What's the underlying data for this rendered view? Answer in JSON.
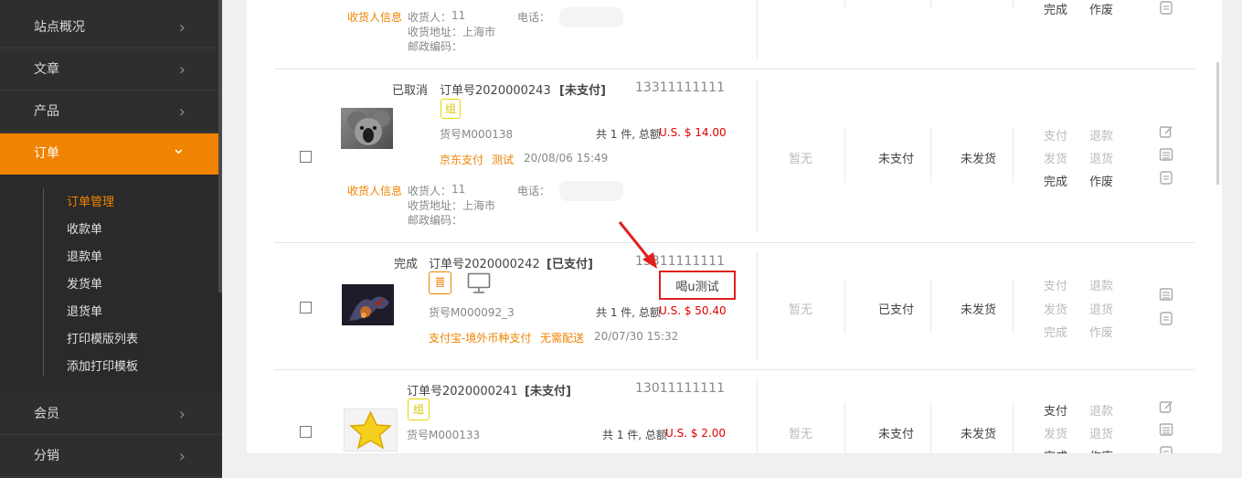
{
  "sidebar": {
    "items": [
      {
        "label": "站点概况",
        "state": "collapsed"
      },
      {
        "label": "文章",
        "state": "collapsed"
      },
      {
        "label": "产品",
        "state": "collapsed"
      },
      {
        "label": "订单",
        "state": "expanded"
      },
      {
        "label": "会员",
        "state": "collapsed"
      },
      {
        "label": "分销",
        "state": "collapsed"
      }
    ],
    "order_submenu": [
      "订单管理",
      "收款单",
      "退款单",
      "发货单",
      "退货单",
      "打印模版列表",
      "添加打印模板"
    ],
    "current_submenu": "订单管理",
    "chevron_right": "›",
    "chevron_down": "⌄"
  },
  "common": {
    "consignee_info": "收货人信息",
    "consignee_prefix": "收货人：",
    "address_prefix": "收货地址：",
    "zip_prefix": "邮政编码：",
    "phone_prefix": "电话：",
    "accent": "#f08300",
    "annotation_color": "#e02020"
  },
  "orders": [
    {
      "partial": "top",
      "consignee": "11",
      "address": "上海市",
      "zip": "",
      "actions": [
        "完成",
        "作废"
      ]
    },
    {
      "status": "已取消",
      "order_no": "订单号2020000243",
      "pay_state_tag": "[未支付]",
      "phone": "13311111111",
      "badge": "组",
      "sku": "货号M000138",
      "qty_text": "共 1 件, 总额",
      "amount": "U.S. $ 14.00",
      "payment": "京东支付",
      "shipping": "测试",
      "time": "20/08/06 15:49",
      "consignee": "11",
      "address": "上海市",
      "zip": "",
      "col_note": "暂无",
      "col_pay": "未支付",
      "col_ship": "未发货",
      "actions": [
        [
          "支付",
          "退款"
        ],
        [
          "发货",
          "退货"
        ],
        [
          "完成",
          "作废"
        ]
      ],
      "thumb": "koala"
    },
    {
      "status": "完成",
      "order_no": "订单号2020000242",
      "pay_state_tag": "[已支付]",
      "phone": "13311111111",
      "badge": "普",
      "has_monitor_icon": true,
      "annotation_text": "喝u测试",
      "sku": "货号M000092_3",
      "qty_text": "共 1 件, 总额",
      "amount": "U.S. $ 50.40",
      "payment": "支付宝-境外币种支付",
      "shipping": "无需配送",
      "time": "20/07/30 15:32",
      "col_note": "暂无",
      "col_pay": "已支付",
      "col_ship": "未发货",
      "actions": [
        [
          "支付",
          "退款"
        ],
        [
          "发货",
          "退货"
        ],
        [
          "完成",
          "作废"
        ]
      ],
      "thumb": "dragon"
    },
    {
      "status": "",
      "order_no": "订单号2020000241",
      "pay_state_tag": "[未支付]",
      "phone": "13011111111",
      "badge": "组",
      "sku": "货号M000133",
      "qty_text": "共 1 件, 总额",
      "amount": "U.S. $ 2.00",
      "col_note": "暂无",
      "col_pay": "未支付",
      "col_ship": "未发货",
      "actions": [
        [
          "支付",
          "退款"
        ],
        [
          "发货",
          "退货"
        ],
        [
          "完成",
          "作废"
        ]
      ],
      "thumb": "star"
    }
  ]
}
